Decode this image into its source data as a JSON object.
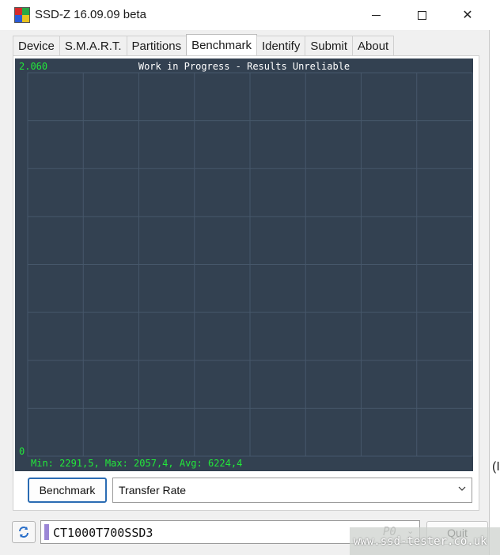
{
  "window": {
    "title": "SSD-Z 16.09.09 beta",
    "controls": {
      "minimize_icon": "minimize-icon",
      "maximize_icon": "maximize-icon",
      "close_icon": "close-icon",
      "close_glyph": "✕"
    }
  },
  "tabs": [
    {
      "label": "Device",
      "active": false
    },
    {
      "label": "S.M.A.R.T.",
      "active": false
    },
    {
      "label": "Partitions",
      "active": false
    },
    {
      "label": "Benchmark",
      "active": true
    },
    {
      "label": "Identify",
      "active": false
    },
    {
      "label": "Submit",
      "active": false
    },
    {
      "label": "About",
      "active": false
    }
  ],
  "chart": {
    "title": "Work in Progress - Results Unreliable",
    "y_max_label": "2.060",
    "y_min_label": "0",
    "stats": "Min: 2291,5, Max: 2057,4, Avg: 6224,4",
    "colors": {
      "background": "#334151",
      "grid": "#46576a",
      "label": "#22e83a",
      "title": "#ffffff"
    }
  },
  "chart_data": {
    "type": "line",
    "title": "Work in Progress - Results Unreliable",
    "ylim": [
      0,
      2.06
    ],
    "grid": true,
    "series": []
  },
  "controls": {
    "benchmark_button": "Benchmark",
    "mode_select": {
      "value": "Transfer Rate",
      "arrow_icon": "chevron-down-icon"
    }
  },
  "footer": {
    "refresh_icon": "refresh-icon",
    "drive_name": "CT1000T700SSD3",
    "drive_slot": "P0",
    "drive_arrow": "⌄",
    "quit_button": "Quit"
  },
  "watermark": "www.ssd-tester.co.uk",
  "edge_glyph": "(I"
}
